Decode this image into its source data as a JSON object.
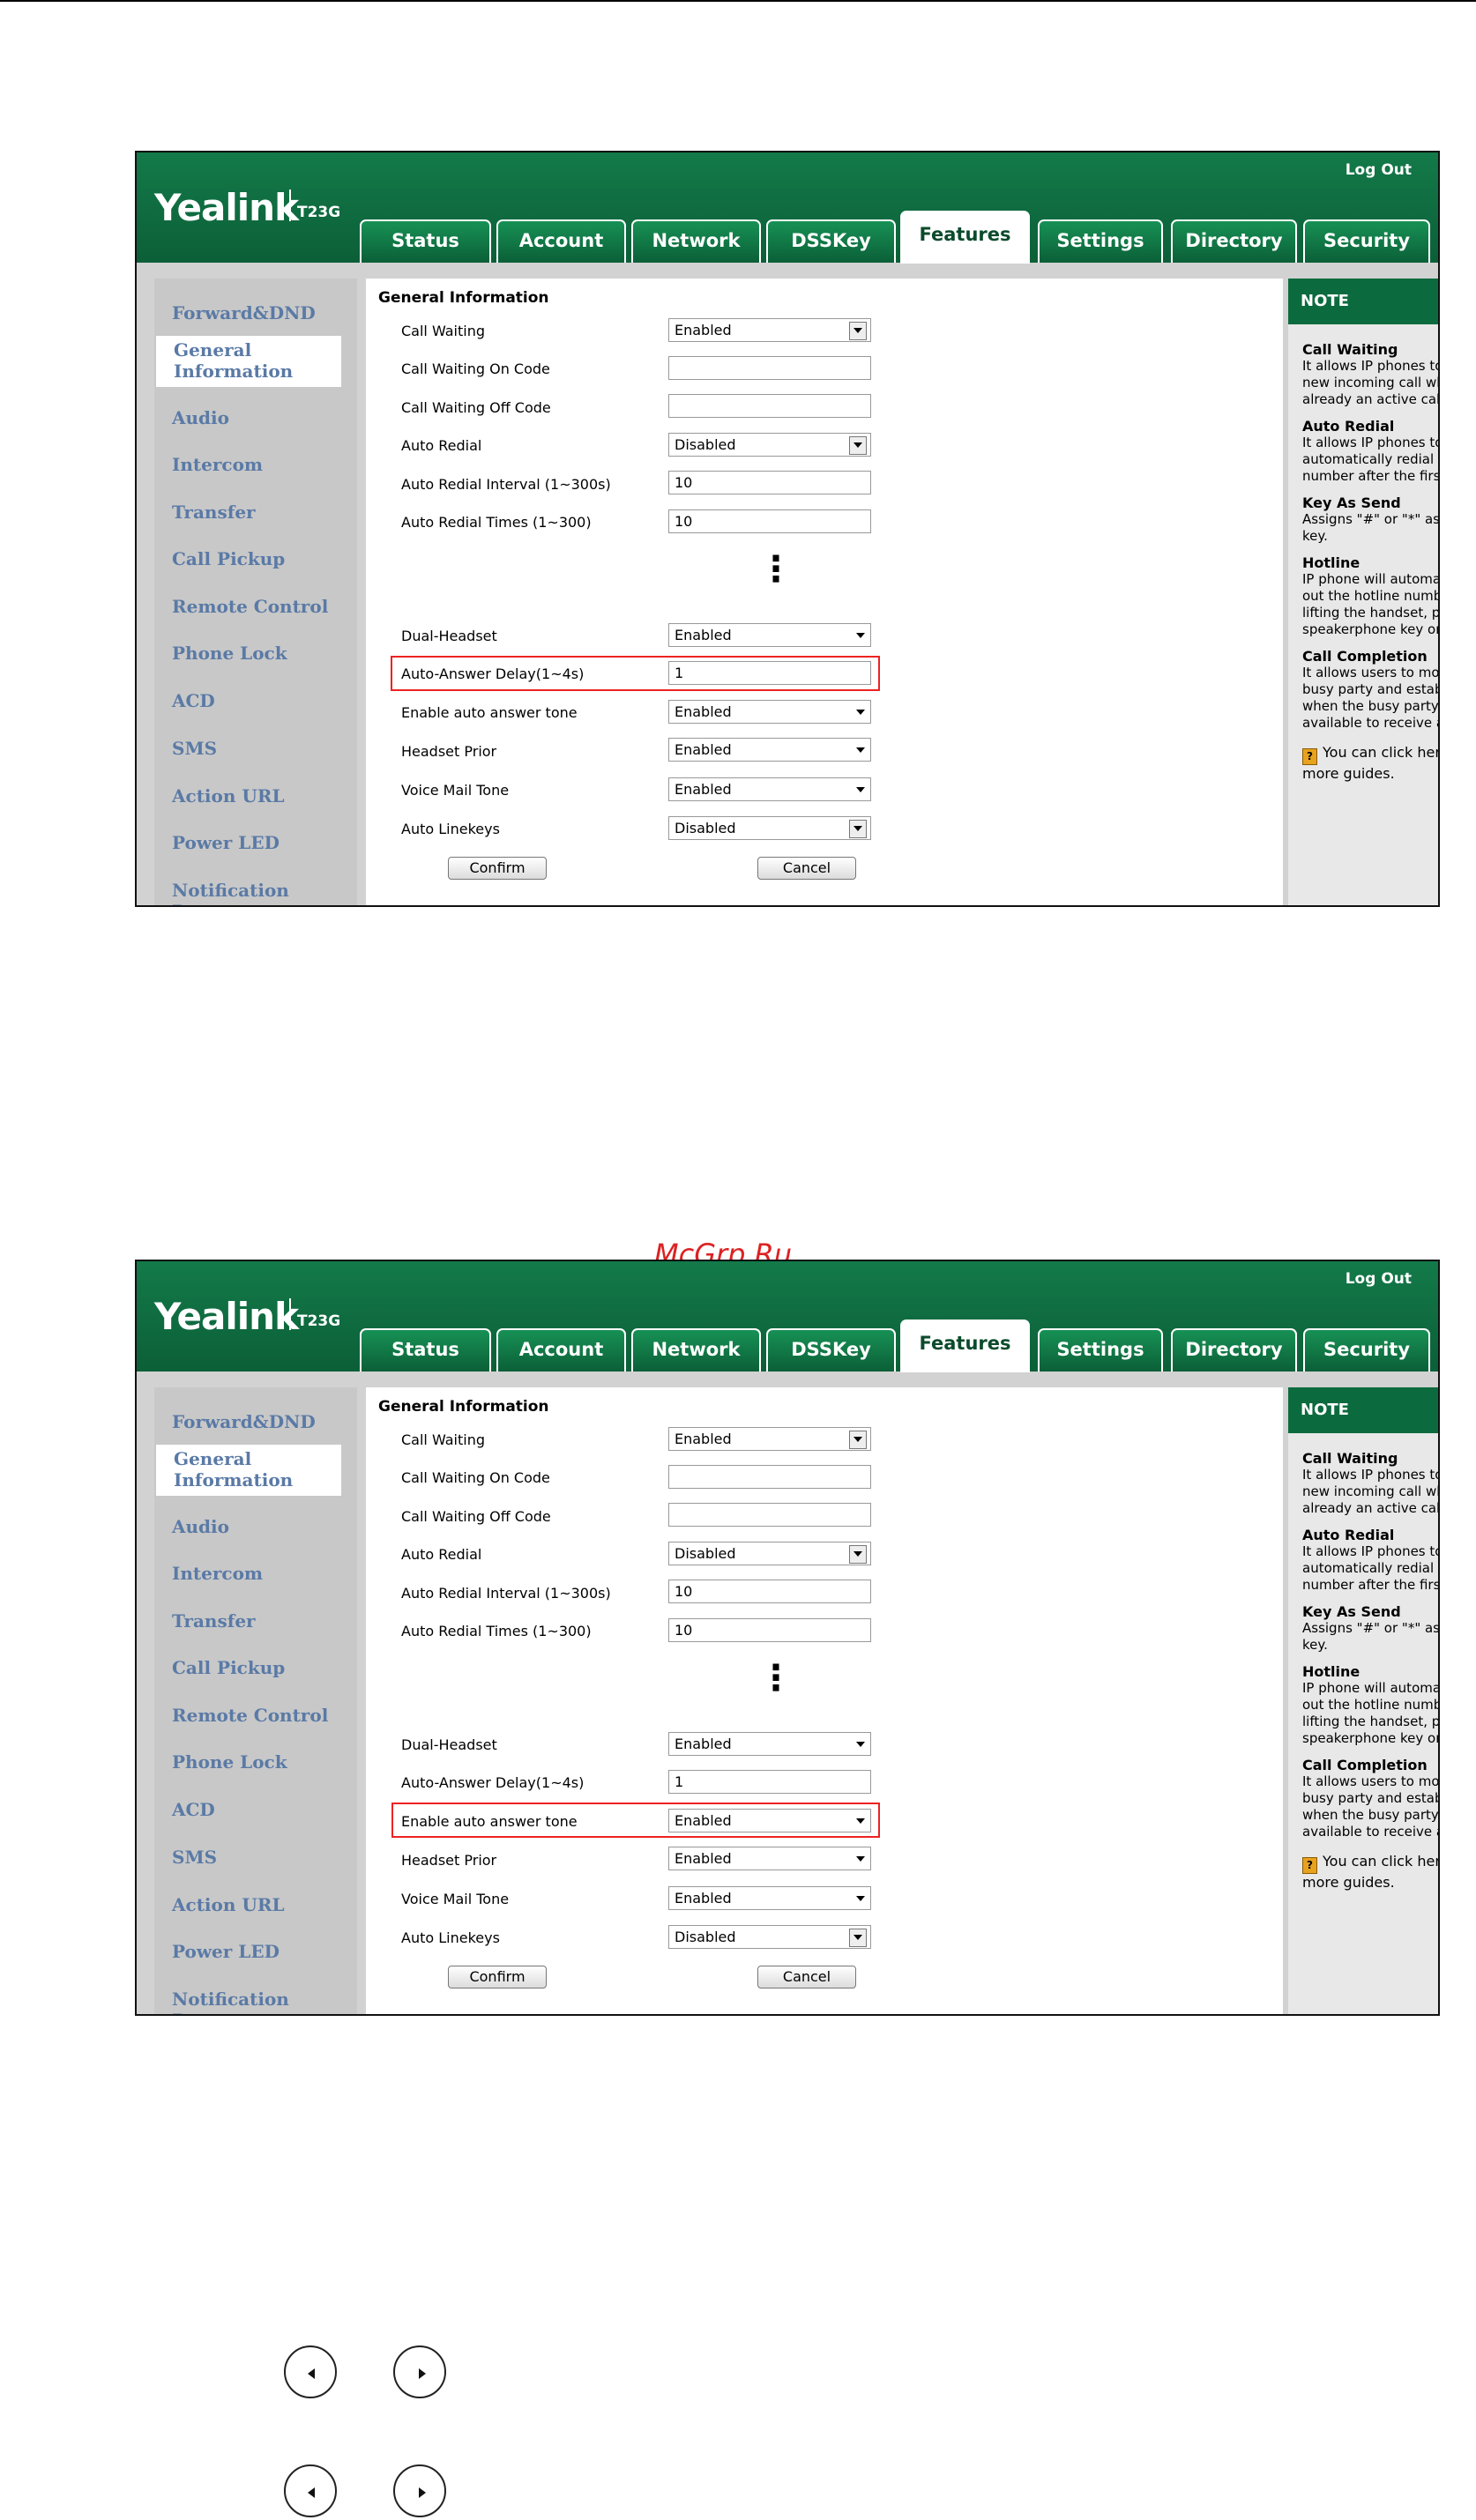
{
  "watermark": "McGrp.Ru",
  "screens": [
    {
      "logo": "Yealink",
      "model": "T23G",
      "logout": "Log Out",
      "tabs": [
        "Status",
        "Account",
        "Network",
        "DSSKey",
        "Features",
        "Settings",
        "Directory",
        "Security"
      ],
      "active_tab": "Features",
      "sidebar": [
        "Forward&DND",
        "General Information",
        "Audio",
        "Intercom",
        "Transfer",
        "Call Pickup",
        "Remote Control",
        "Phone Lock",
        "ACD",
        "SMS",
        "Action URL",
        "Power LED",
        "Notification Popups"
      ],
      "section_title": "General Information",
      "rows_top": [
        {
          "label": "Call Waiting",
          "value": "Enabled"
        },
        {
          "label": "Call Waiting On Code",
          "value": ""
        },
        {
          "label": "Call Waiting Off Code",
          "value": ""
        },
        {
          "label": "Auto Redial",
          "value": "Disabled"
        },
        {
          "label": "Auto Redial Interval (1~300s)",
          "value": "10"
        },
        {
          "label": "Auto Redial Times (1~300)",
          "value": "10"
        }
      ],
      "dots": "⋮",
      "rows_bottom": [
        {
          "label": "Dual-Headset",
          "value": "Enabled"
        },
        {
          "label": "Auto-Answer Delay(1~4s)",
          "value": "1"
        },
        {
          "label": "Enable auto answer tone",
          "value": "Enabled"
        },
        {
          "label": "Headset Prior",
          "value": "Enabled"
        },
        {
          "label": "Voice Mail Tone",
          "value": "Enabled"
        },
        {
          "label": "Auto Linekeys",
          "value": "Disabled"
        }
      ],
      "highlighted_row": "Auto-Answer Delay(1~4s)",
      "buttons": {
        "confirm": "Confirm",
        "cancel": "Cancel"
      },
      "note": {
        "title": "NOTE",
        "items": [
          {
            "heading": "Call Waiting",
            "text": "It allows IP phones to receive a new incoming call when there is already an active call."
          },
          {
            "heading": "Auto Redial",
            "text": "It allows IP phones to automatically redial a busy number after the first attempt."
          },
          {
            "heading": "Key As Send",
            "text": "Assigns \"#\" or \"*\" as the send key."
          },
          {
            "heading": "Hotline",
            "text": "IP phone will automatically dial out the hotline number when lifting the handset, pressing the speakerphone key or the line key."
          },
          {
            "heading": "Call Completion",
            "text": "It allows users to monitor the busy party and establish a call when the busy party becomes available to receive a call."
          }
        ],
        "guide": "You can click here to get more guides."
      }
    },
    {
      "logo": "Yealink",
      "model": "T23G",
      "logout": "Log Out",
      "tabs": [
        "Status",
        "Account",
        "Network",
        "DSSKey",
        "Features",
        "Settings",
        "Directory",
        "Security"
      ],
      "active_tab": "Features",
      "sidebar": [
        "Forward&DND",
        "General Information",
        "Audio",
        "Intercom",
        "Transfer",
        "Call Pickup",
        "Remote Control",
        "Phone Lock",
        "ACD",
        "SMS",
        "Action URL",
        "Power LED",
        "Notification Popups"
      ],
      "section_title": "General Information",
      "rows_top": [
        {
          "label": "Call Waiting",
          "value": "Enabled"
        },
        {
          "label": "Call Waiting On Code",
          "value": ""
        },
        {
          "label": "Call Waiting Off Code",
          "value": ""
        },
        {
          "label": "Auto Redial",
          "value": "Disabled"
        },
        {
          "label": "Auto Redial Interval (1~300s)",
          "value": "10"
        },
        {
          "label": "Auto Redial Times (1~300)",
          "value": "10"
        }
      ],
      "dots": "⋮",
      "rows_bottom": [
        {
          "label": "Dual-Headset",
          "value": "Enabled"
        },
        {
          "label": "Auto-Answer Delay(1~4s)",
          "value": "1"
        },
        {
          "label": "Enable auto answer tone",
          "value": "Enabled"
        },
        {
          "label": "Headset Prior",
          "value": "Enabled"
        },
        {
          "label": "Voice Mail Tone",
          "value": "Enabled"
        },
        {
          "label": "Auto Linekeys",
          "value": "Disabled"
        }
      ],
      "highlighted_row": "Enable auto answer tone",
      "buttons": {
        "confirm": "Confirm",
        "cancel": "Cancel"
      },
      "note": {
        "title": "NOTE",
        "items": [
          {
            "heading": "Call Waiting",
            "text": "It allows IP phones to receive a new incoming call when there is already an active call."
          },
          {
            "heading": "Auto Redial",
            "text": "It allows IP phones to automatically redial a busy number after the first attempt."
          },
          {
            "heading": "Key As Send",
            "text": "Assigns \"#\" or \"*\" as the send key."
          },
          {
            "heading": "Hotline",
            "text": "IP phone will automatically dial out the hotline number when lifting the handset, pressing the speakerphone key or the line key."
          },
          {
            "heading": "Call Completion",
            "text": "It allows users to monitor the busy party and establish a call when the busy party becomes available to receive a call."
          }
        ],
        "guide": "You can click here to get more guides."
      }
    }
  ],
  "key_icons": [
    {
      "name": "left-key",
      "direction": "left"
    },
    {
      "name": "right-key",
      "direction": "right"
    },
    {
      "name": "left-key",
      "direction": "left"
    },
    {
      "name": "right-key",
      "direction": "right"
    }
  ]
}
